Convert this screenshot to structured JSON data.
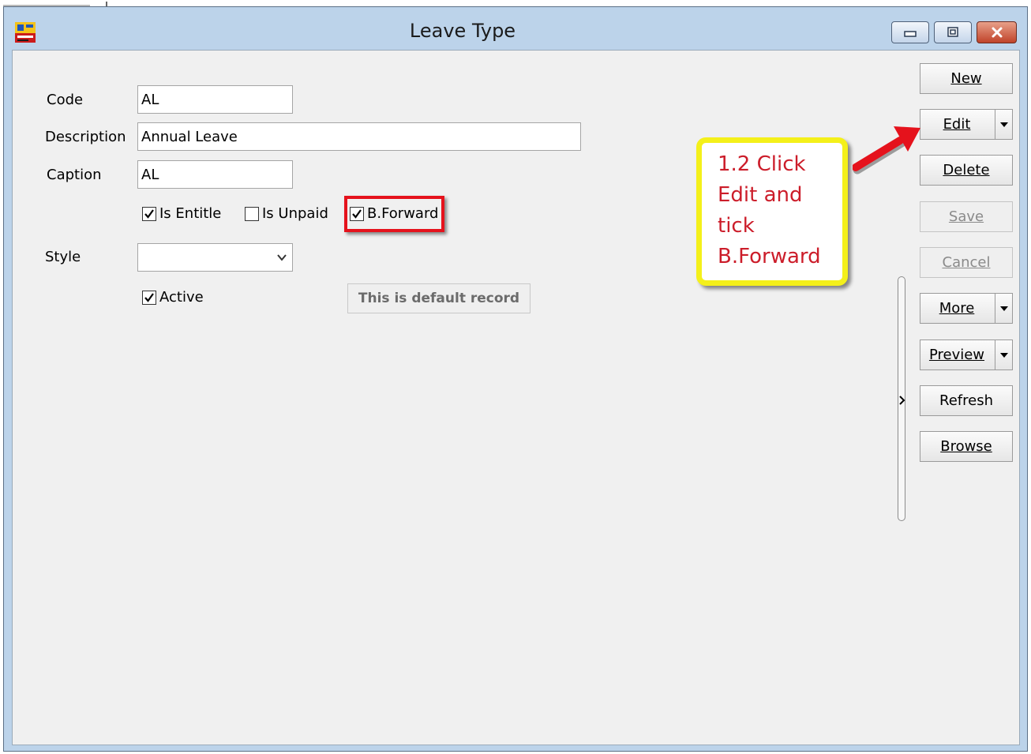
{
  "window": {
    "title": "Leave Type"
  },
  "form": {
    "code_label": "Code",
    "code_value": "AL",
    "description_label": "Description",
    "description_value": "Annual Leave",
    "caption_label": "Caption",
    "caption_value": "AL",
    "is_entitle_label": "Is Entitle",
    "is_entitle_checked": true,
    "is_unpaid_label": "Is Unpaid",
    "is_unpaid_checked": false,
    "b_forward_label": "B.Forward",
    "b_forward_checked": true,
    "style_label": "Style",
    "style_value": "",
    "active_label": "Active",
    "active_checked": true,
    "default_record_text": "This is default record"
  },
  "toolbar": {
    "new": "New",
    "edit": "Edit",
    "delete": "Delete",
    "save": "Save",
    "cancel": "Cancel",
    "more": "More",
    "preview": "Preview",
    "refresh": "Refresh",
    "browse": "Browse"
  },
  "annotation": {
    "callout_text": "1.2 Click\nEdit and\ntick\nB.Forward"
  },
  "colors": {
    "annotation_red": "#e5121c",
    "callout_border": "#f4f01a",
    "callout_text": "#cc1d2a",
    "titlebar": "#bcd3ea"
  }
}
